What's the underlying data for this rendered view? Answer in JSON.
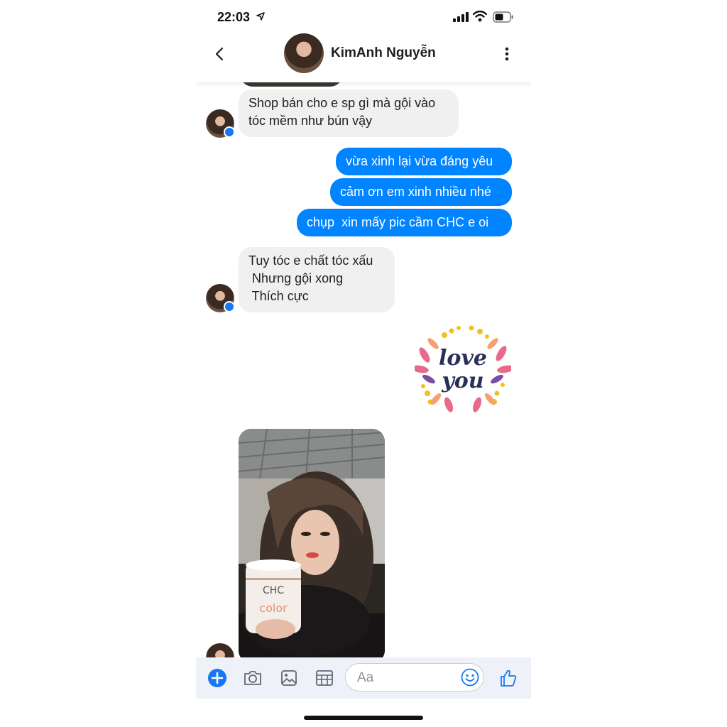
{
  "status_bar": {
    "time": "22:03"
  },
  "header": {
    "contact_name": "KimAnh Nguyễn"
  },
  "messages": [
    {
      "direction": "in",
      "text": "Shop bán cho e sp gì mà gội vào\ntóc mềm như bún vậy"
    },
    {
      "direction": "out",
      "text": "vừa xinh lại vừa đáng yêu"
    },
    {
      "direction": "out",
      "text": "cảm ơn em xinh nhiều nhé"
    },
    {
      "direction": "out",
      "text": "chụp  xin mấy pic cầm CHC e oi"
    },
    {
      "direction": "in",
      "text": "Tuy tóc e chất tóc xấu\n Nhưng gội xong\n Thích cực"
    }
  ],
  "sticker": {
    "line1": "love",
    "line2": "you"
  },
  "photo": {
    "product_label": "CHC"
  },
  "composer": {
    "placeholder": "Aa"
  },
  "colors": {
    "accent": "#0084ff",
    "incoming_bubble": "#f1f0f0",
    "composer_bg": "#eef2f8"
  },
  "icons": [
    "location-arrow-icon",
    "signal-icon",
    "wifi-icon",
    "battery-icon",
    "back-chevron-icon",
    "more-vertical-icon",
    "messenger-badge-icon",
    "plus-icon",
    "camera-icon",
    "gallery-icon",
    "gif-grid-icon",
    "emoji-icon",
    "like-thumb-icon"
  ]
}
